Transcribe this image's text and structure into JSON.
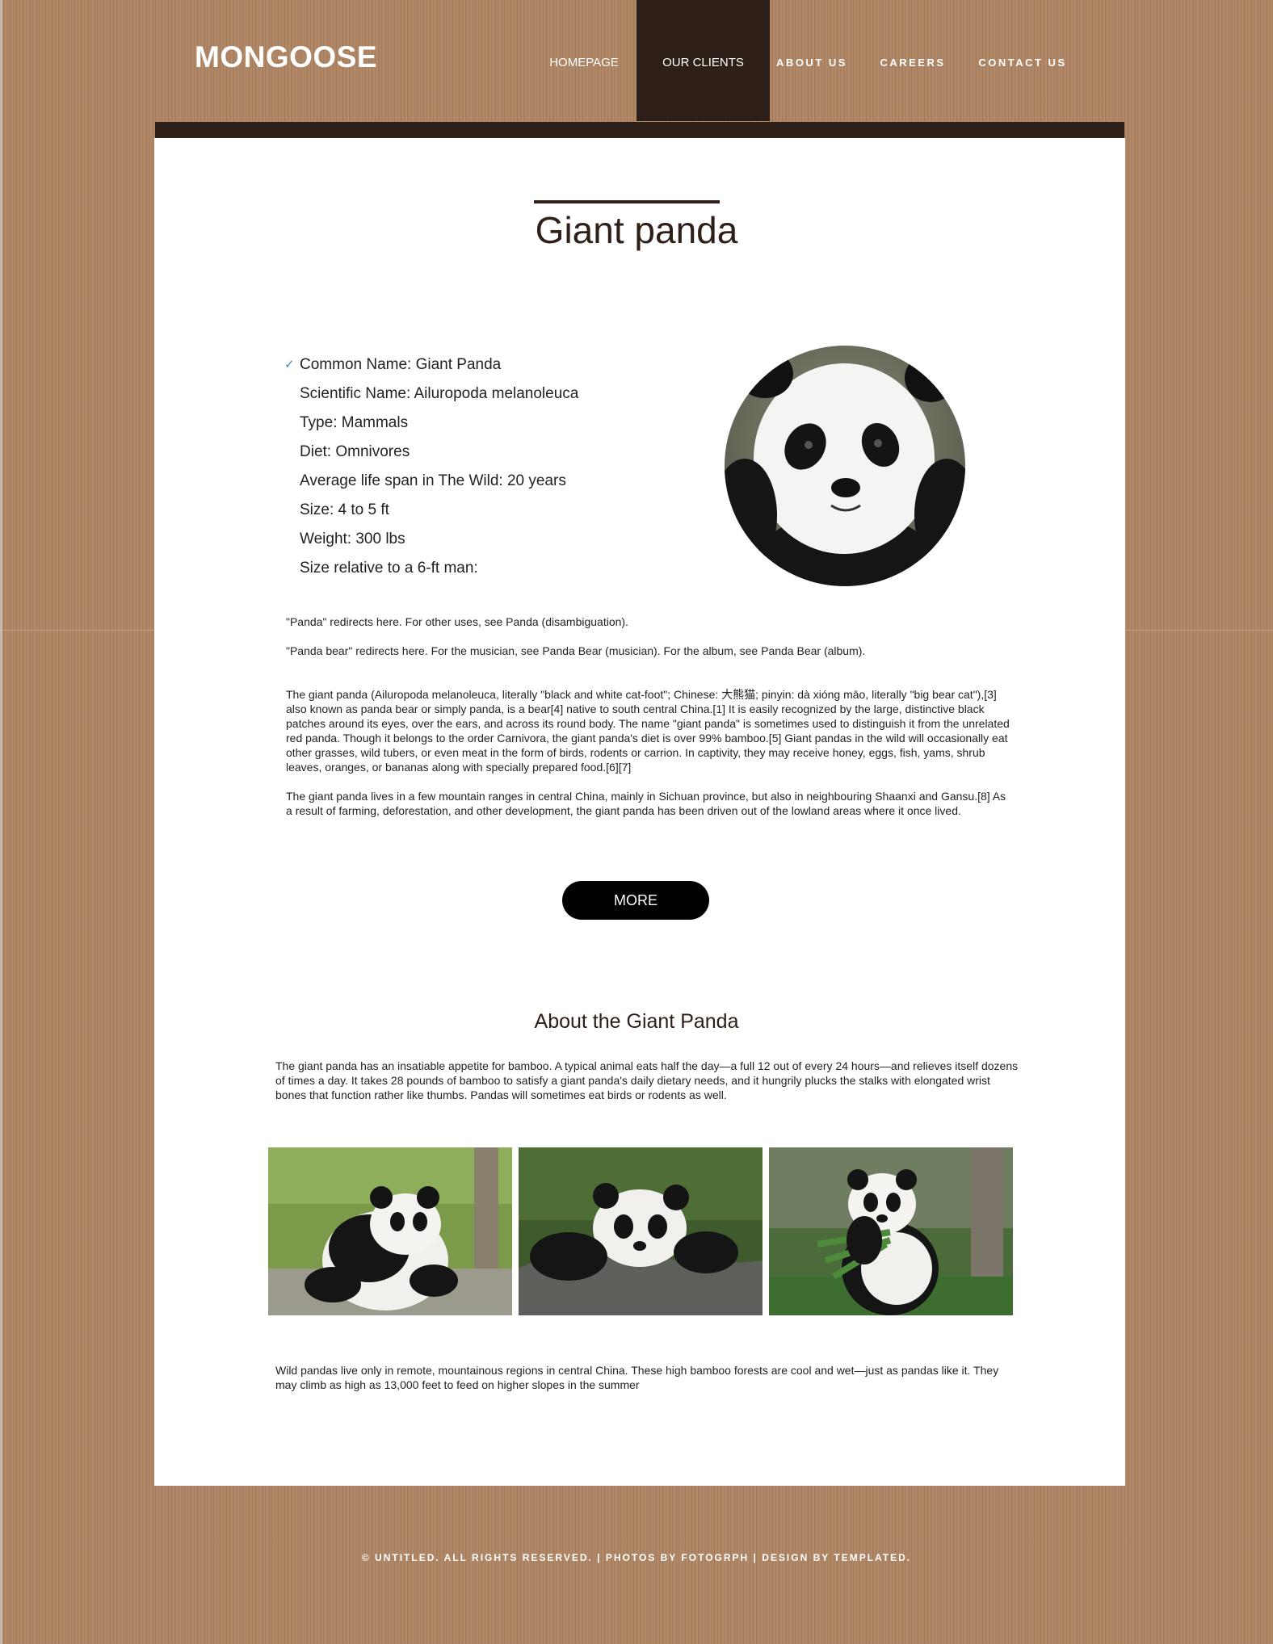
{
  "site": {
    "logo": "MONGOOSE"
  },
  "nav": {
    "homepage": "HOMEPAGE",
    "our_clients": "OUR CLIENTS",
    "about_us": "ABOUT US",
    "careers": "CAREERS",
    "contact_us": "CONTACT US",
    "active": "OUR CLIENTS"
  },
  "main": {
    "title": "Giant panda",
    "facts": [
      "Common Name: Giant Panda",
      "Scientific Name: Ailuropoda melanoleuca",
      "Type: Mammals",
      "Diet: Omnivores",
      "Average life span in The Wild: 20 years",
      "Size: 4 to 5 ft",
      "Weight: 300 lbs",
      "Size relative to a 6-ft man:"
    ],
    "redirect_1": "\"Panda\" redirects here. For other uses, see Panda (disambiguation).",
    "redirect_2": "\"Panda bear\" redirects here. For the musician, see Panda Bear (musician). For the album, see Panda Bear (album).",
    "paragraph_1": "The giant panda (Ailuropoda melanoleuca, literally \"black and white cat-foot\"; Chinese: 大熊猫; pinyin: dà xióng māo, literally \"big bear cat\"),[3] also known as panda bear or simply panda, is a bear[4] native to south central China.[1] It is easily recognized by the large, distinctive black patches around its eyes, over the ears, and across its round body. The name \"giant panda\" is sometimes used to distinguish it from the unrelated red panda. Though it belongs to the order Carnivora, the giant panda's diet is over 99% bamboo.[5] Giant pandas in the wild will occasionally eat other grasses, wild tubers, or even meat in the form of birds, rodents or carrion. In captivity, they may receive honey, eggs, fish, yams, shrub leaves, oranges, or bananas along with specially prepared food.[6][7]",
    "paragraph_2": "The giant panda lives in a few mountain ranges in central China, mainly in Sichuan province, but also in neighbouring Shaanxi and Gansu.[8] As a result of farming, deforestation, and other development, the giant panda has been driven out of the lowland areas where it once lived.",
    "more_button": "MORE"
  },
  "about": {
    "title": "About the Giant Panda",
    "paragraph_1": "The giant panda has an insatiable appetite for bamboo. A typical animal eats half the day—a full 12 out of every 24 hours—and relieves itself dozens of times a day. It takes 28 pounds of bamboo to satisfy a giant panda's daily dietary needs, and it hungrily plucks the stalks with elongated wrist bones that function rather like thumbs. Pandas will sometimes eat birds or rodents as well.",
    "paragraph_2": "Wild pandas live only in remote, mountainous regions in central China. These high bamboo forests are cool and wet—just as pandas like it. They may climb as high as 13,000 feet to feed on higher slopes in the summer"
  },
  "footer": {
    "text": "© UNTITLED. ALL RIGHTS RESERVED. | PHOTOS BY FOTOGRPH | DESIGN BY TEMPLATED."
  },
  "colors": {
    "background_wood": "#b08664",
    "header_dark": "#2e2018",
    "check_accent": "#3a87c8",
    "button": "#000000"
  },
  "icons": {
    "fact_bullet": "checkmark-icon"
  }
}
